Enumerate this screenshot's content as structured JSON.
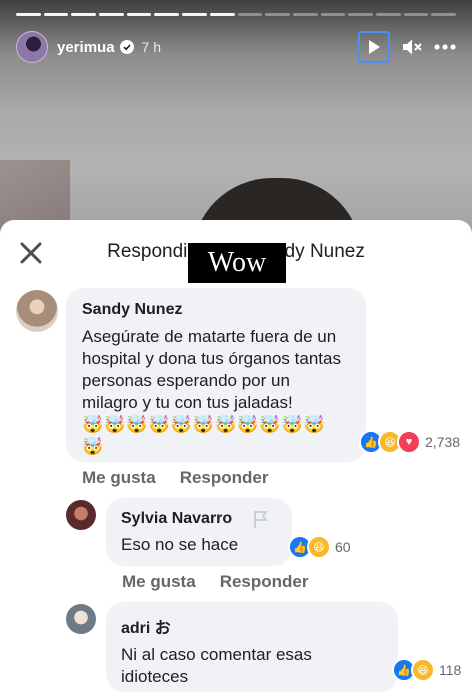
{
  "story": {
    "username": "yerimua",
    "time": "7 h",
    "segments": 16,
    "segments_viewed": 8
  },
  "sheet": {
    "title": "Respondiendo a Sandy Nunez",
    "overlay_label": "Wow"
  },
  "comments": [
    {
      "author": "Sandy Nunez",
      "text": "Asegúrate de matarte fuera de un hospital y dona tus órganos tantas personas esperando por un milagro y tu con tus jaladas!",
      "emojis": "🤯🤯🤯🤯🤯🤯🤯🤯🤯🤯🤯🤯",
      "reactions": [
        "like",
        "haha",
        "love"
      ],
      "reaction_count": "2,738",
      "actions": [
        "Me gusta",
        "Responder"
      ]
    },
    {
      "author": "Sylvia Navarro",
      "text": "Eso no se hace",
      "reactions": [
        "like",
        "haha"
      ],
      "reaction_count": "60",
      "actions": [
        "Me gusta",
        "Responder"
      ]
    },
    {
      "author": "adri お",
      "text": "Ni al caso comentar esas idioteces",
      "reactions": [
        "like",
        "haha"
      ],
      "reaction_count": "118"
    }
  ],
  "icons": {
    "verified": "verified-badge-icon",
    "play": "play-icon",
    "mute": "muted-speaker-icon",
    "more": "more-dots-icon",
    "close": "close-icon",
    "flag": "flag-icon"
  },
  "colors": {
    "like": "#1877f2",
    "haha": "#f7b928",
    "love": "#f33e58",
    "focus_ring": "#4c8df6"
  }
}
